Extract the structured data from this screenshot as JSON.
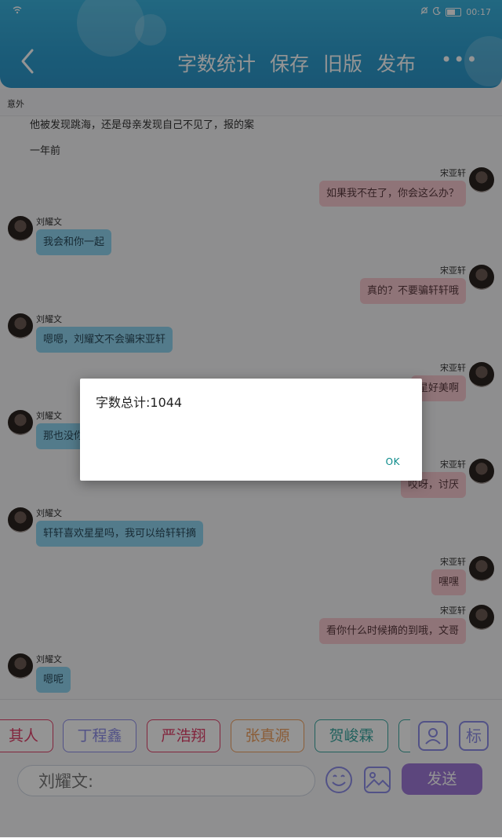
{
  "status": {
    "time": "00:17"
  },
  "header": {
    "menu": [
      "字数统计",
      "保存",
      "旧版",
      "发布"
    ],
    "more": "•••"
  },
  "subtitle": "意外",
  "narration": [
    "他被发现跳海，还是母亲发现自己不见了，报的案",
    "一年前"
  ],
  "messages": [
    {
      "side": "right",
      "name": "宋亚轩",
      "text": "如果我不在了，你会这么办？"
    },
    {
      "side": "left",
      "name": "刘耀文",
      "text": "我会和你一起"
    },
    {
      "side": "right",
      "name": "宋亚轩",
      "text": "真的？不要骗轩轩哦"
    },
    {
      "side": "left",
      "name": "刘耀文",
      "text": "嗯嗯，刘耀文不会骗宋亚轩"
    },
    {
      "side": "right",
      "name": "宋亚轩",
      "text": "星好美啊"
    },
    {
      "side": "left",
      "name": "刘耀文",
      "text": "那也没你"
    },
    {
      "side": "right",
      "name": "宋亚轩",
      "text": "哎呀，讨厌"
    },
    {
      "side": "left",
      "name": "刘耀文",
      "text": "轩轩喜欢星星吗，我可以给轩轩摘"
    },
    {
      "side": "right",
      "name": "宋亚轩",
      "text": "嘿嘿"
    },
    {
      "side": "right",
      "name": "宋亚轩",
      "text": "看你什么时候摘的到哦，文哥"
    },
    {
      "side": "left",
      "name": "刘耀文",
      "text": "嗯呢"
    }
  ],
  "characters": [
    {
      "label": "其人",
      "color": "#e0406a"
    },
    {
      "label": "丁程鑫",
      "color": "#8e8ee8"
    },
    {
      "label": "严浩翔",
      "color": "#e0406a"
    },
    {
      "label": "张真源",
      "color": "#f0a060"
    },
    {
      "label": "贺峻霖",
      "color": "#3aa7a0"
    }
  ],
  "side_button_label": "标",
  "input": {
    "value": "刘耀文:"
  },
  "send_label": "发送",
  "dialog": {
    "text": "字数总计:1044",
    "ok": "OK"
  }
}
